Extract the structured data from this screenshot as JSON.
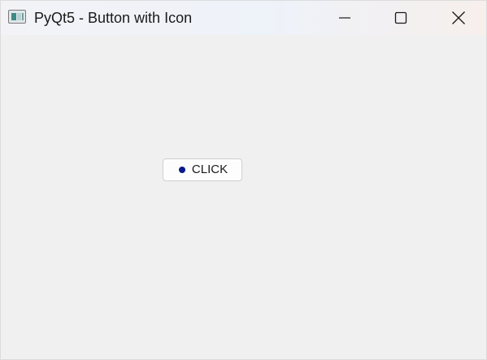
{
  "window": {
    "title": "PyQt5 - Button with Icon",
    "icon": "app-window-icon",
    "controls": {
      "minimize_icon": "minimize-icon",
      "maximize_icon": "maximize-icon",
      "close_icon": "close-icon"
    }
  },
  "main": {
    "button": {
      "label": "CLICK",
      "icon": "dot-icon",
      "icon_color": "#0b1a8a"
    }
  },
  "colors": {
    "background": "#f0f0f0",
    "button_background": "#fdfdfd",
    "button_border": "#d0d0d0"
  }
}
